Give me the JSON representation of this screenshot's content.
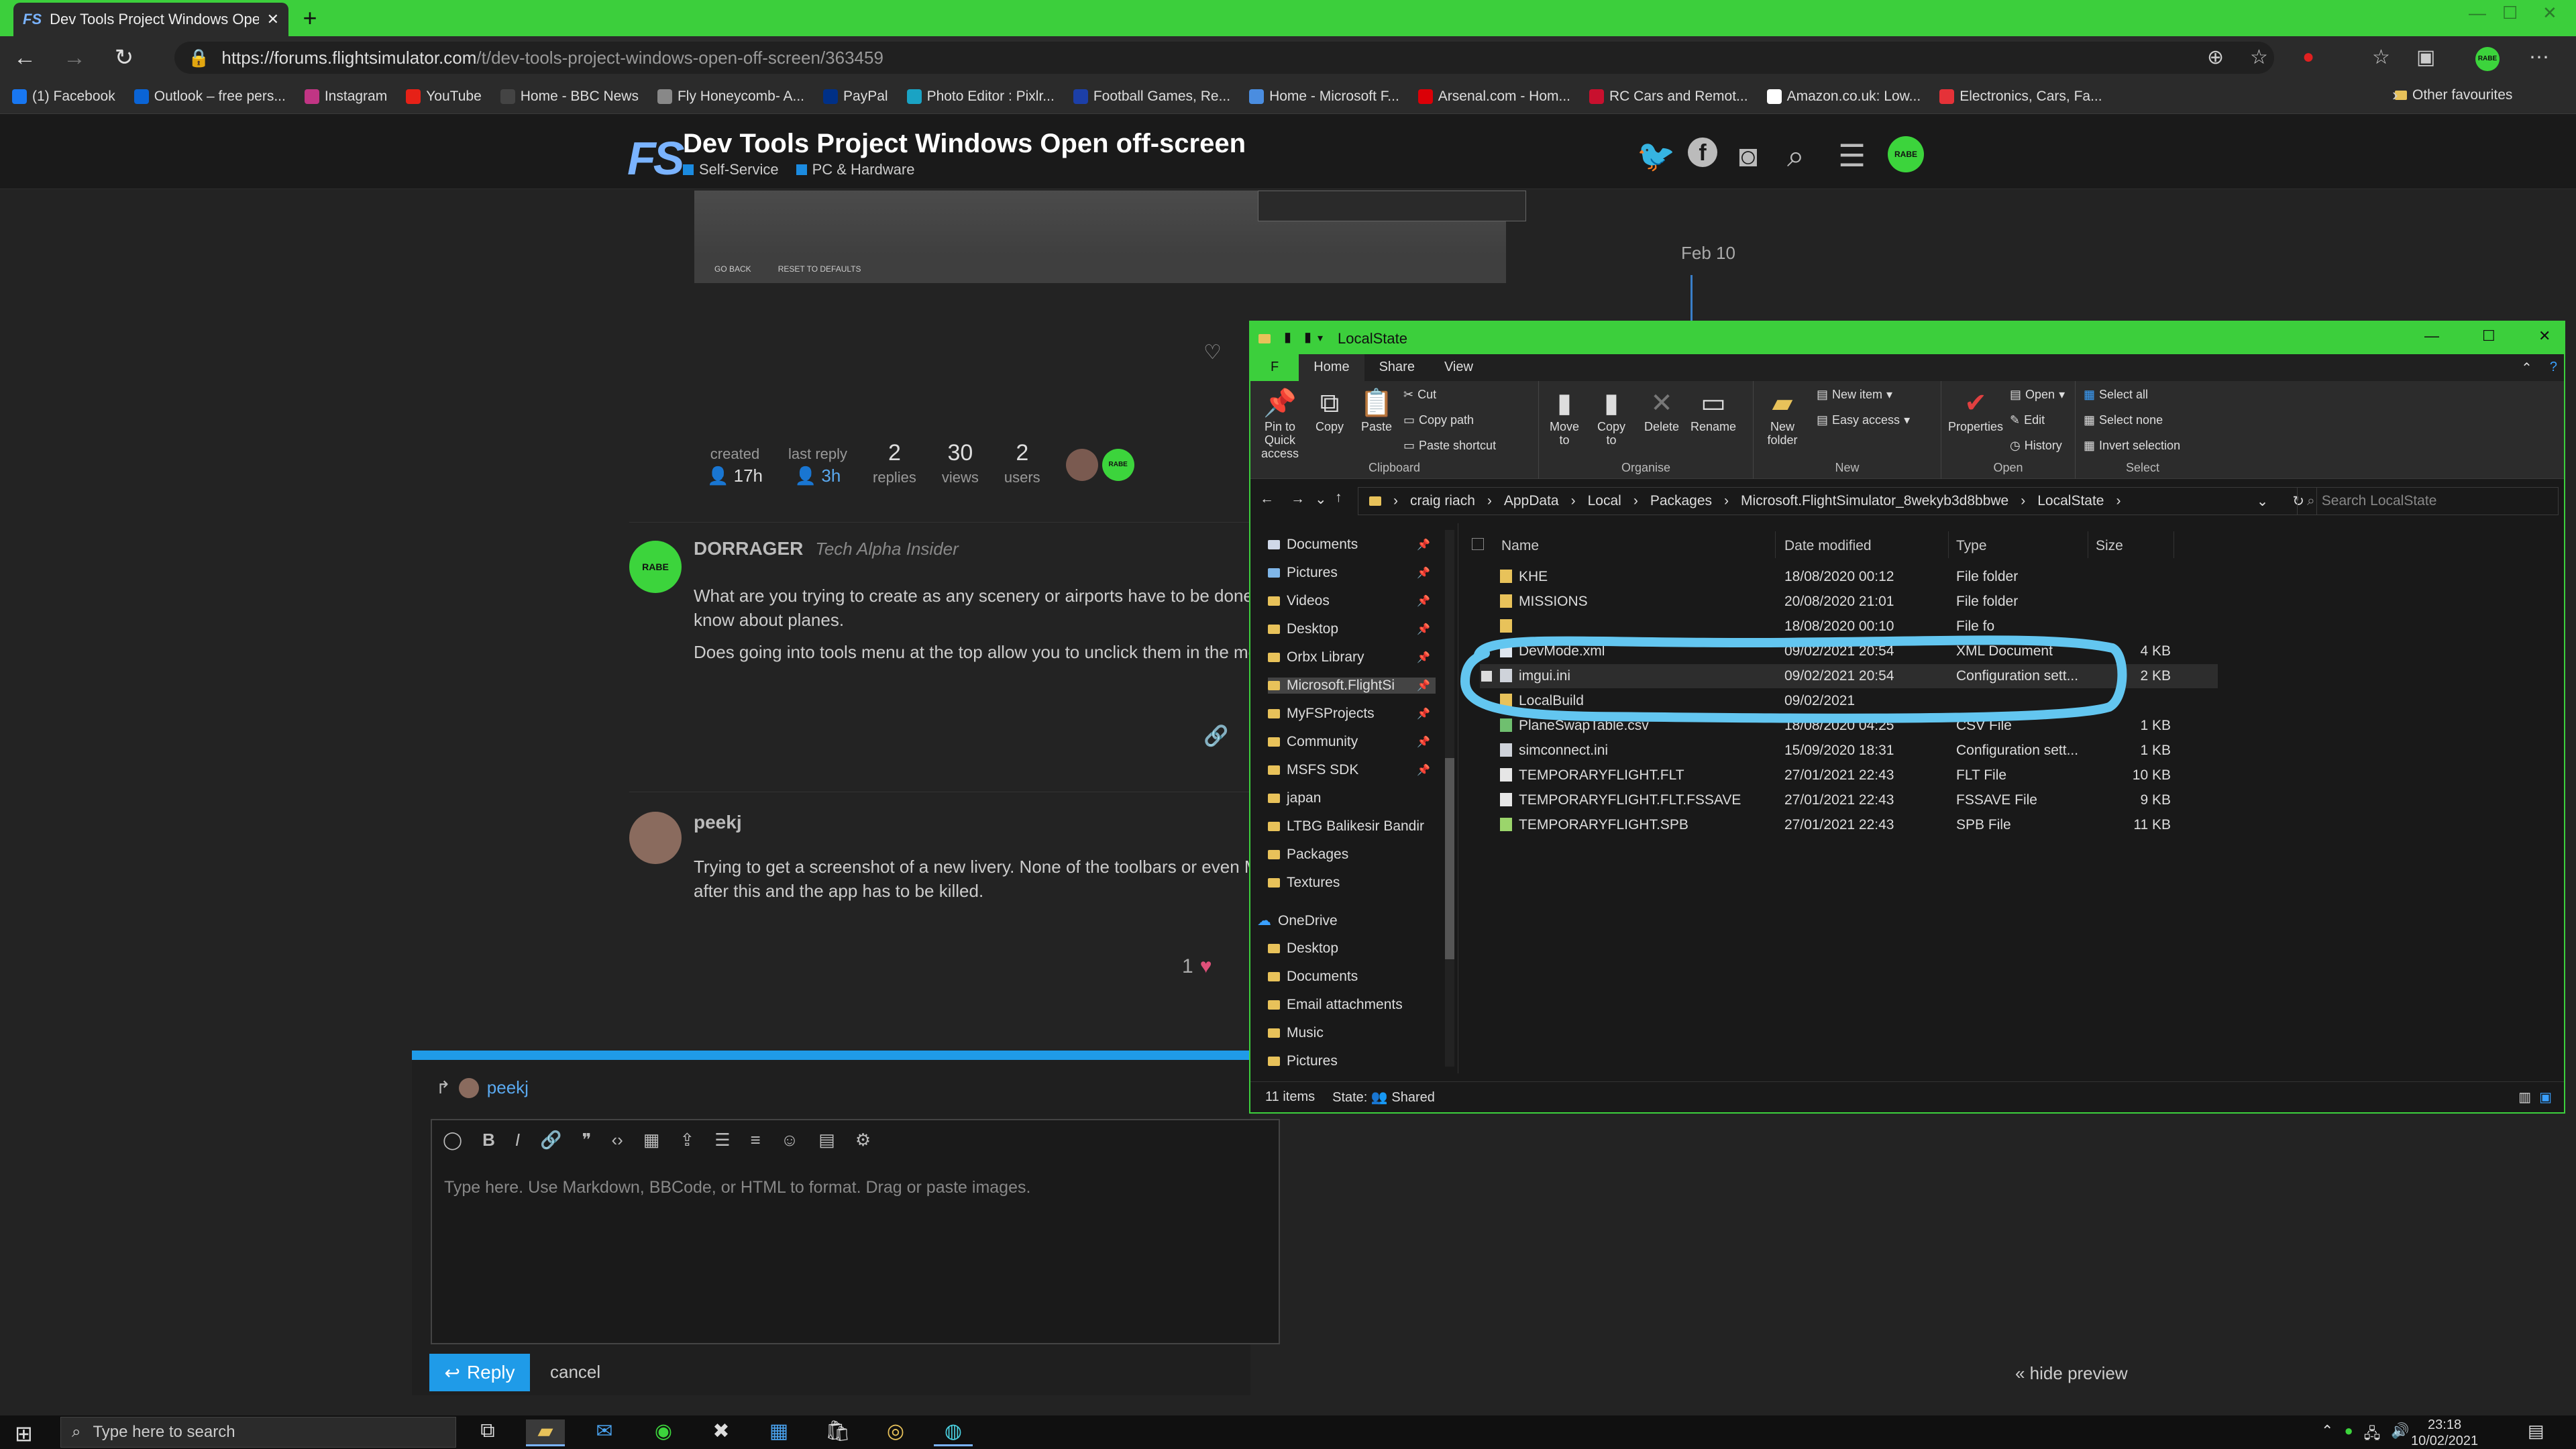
{
  "browser": {
    "tab_title": "Dev Tools Project Windows Open",
    "url_host": "https://forums.flightsimulator.com",
    "url_path": "/t/dev-tools-project-windows-open-off-screen/363459",
    "bookmarks": [
      {
        "label": "(1) Facebook",
        "color": "#1877f2"
      },
      {
        "label": "Outlook – free pers...",
        "color": "#0a64d6"
      },
      {
        "label": "Instagram",
        "color": "#c13584"
      },
      {
        "label": "YouTube",
        "color": "#e62117"
      },
      {
        "label": "Home - BBC News",
        "color": "#444444"
      },
      {
        "label": "Fly Honeycomb- A...",
        "color": "#888888"
      },
      {
        "label": "PayPal",
        "color": "#003087"
      },
      {
        "label": "Photo Editor : Pixlr...",
        "color": "#1aa3c4"
      },
      {
        "label": "Football Games, Re...",
        "color": "#1c3fa8"
      },
      {
        "label": "Home - Microsoft F...",
        "color": "#4a8de0"
      },
      {
        "label": "Arsenal.com - Hom...",
        "color": "#db0007"
      },
      {
        "label": "RC Cars and Remot...",
        "color": "#c8102e"
      },
      {
        "label": "Amazon.co.uk: Low...",
        "color": "#ffffff"
      },
      {
        "label": "Electronics, Cars, Fa...",
        "color": "#e53238"
      }
    ],
    "other_favourites": "Other favourites"
  },
  "site": {
    "logo": "FS",
    "title": "Dev Tools Project Windows Open off-screen",
    "categories": [
      "Self-Service",
      "PC & Hardware"
    ],
    "avatar_text": "RABE",
    "image_buttons": [
      "GO BACK",
      "RESET TO DEFAULTS"
    ],
    "date_marker": "Feb 10",
    "stats": {
      "created_label": "created",
      "created_value": "17h",
      "last_reply_label": "last reply",
      "last_reply_value": "3h",
      "replies_num": "2",
      "replies_label": "replies",
      "views_num": "30",
      "views_label": "views",
      "users_num": "2",
      "users_label": "users"
    },
    "posts": [
      {
        "author": "DORRAGER",
        "flair": "Tech Alpha Insider",
        "line1": "What are you trying to create as any scenery or airports have to be done c",
        "line2": "know about planes.",
        "line3": "Does going into tools menu at the top allow you to unclick them in the me"
      },
      {
        "author": "peekj",
        "flair": "",
        "line1": "Trying to get a screenshot of a new livery. None of the toolbars or even M",
        "line2": "after this and the app has to be killed.",
        "likes": "1"
      }
    ],
    "composer": {
      "reply_to": "peekj",
      "placeholder": "Type here. Use Markdown, BBCode, or HTML to format. Drag or paste images.",
      "reply_label": "Reply",
      "cancel_label": "cancel",
      "hide_preview": "« hide preview"
    }
  },
  "explorer": {
    "title": "LocalState",
    "tabs": [
      "Home",
      "Share",
      "View"
    ],
    "file_tab": "F",
    "ribbon": {
      "pin_label": "Pin to Quick access",
      "copy": "Copy",
      "paste": "Paste",
      "cut": "Cut",
      "copy_path": "Copy path",
      "paste_shortcut": "Paste shortcut",
      "clipboard": "Clipboard",
      "move_to": "Move to",
      "copy_to": "Copy to",
      "delete": "Delete",
      "rename": "Rename",
      "organise": "Organise",
      "new_folder": "New folder",
      "new_item": "New item",
      "easy_access": "Easy access",
      "new": "New",
      "properties": "Properties",
      "open": "Open",
      "edit": "Edit",
      "history": "History",
      "open_group": "Open",
      "select_all": "Select all",
      "select_none": "Select none",
      "invert_selection": "Invert selection",
      "select": "Select"
    },
    "path": [
      "craig riach",
      "AppData",
      "Local",
      "Packages",
      "Microsoft.FlightSimulator_8wekyb3d8bbwe",
      "LocalState"
    ],
    "search_placeholder": "Search LocalState",
    "nav": [
      "Documents",
      "Pictures",
      "Videos",
      "Desktop",
      "Orbx Library",
      "Microsoft.FlightSi",
      "MyFSProjects",
      "Community",
      "MSFS SDK",
      "japan",
      "LTBG Balikesir Bandir",
      "Packages",
      "Textures"
    ],
    "onedrive": "OneDrive",
    "onedrive_items": [
      "Desktop",
      "Documents",
      "Email attachments",
      "Music",
      "Pictures"
    ],
    "columns": {
      "name": "Name",
      "date": "Date modified",
      "type": "Type",
      "size": "Size"
    },
    "files": [
      {
        "name": "KHE",
        "date": "18/08/2020 00:12",
        "type": "File folder",
        "size": "",
        "icon": "folder"
      },
      {
        "name": "MISSIONS",
        "date": "20/08/2020 21:01",
        "type": "File folder",
        "size": "",
        "icon": "folder"
      },
      {
        "name": "",
        "date": "18/08/2020 00:10",
        "type": "File fo",
        "size": "",
        "icon": "folder"
      },
      {
        "name": "DevMode.xml",
        "date": "09/02/2021 20:54",
        "type": "XML Document",
        "size": "4 KB",
        "icon": "xml"
      },
      {
        "name": "imgui.ini",
        "date": "09/02/2021 20:54",
        "type": "Configuration sett...",
        "size": "2 KB",
        "icon": "ini"
      },
      {
        "name": "LocalBuild",
        "date": "09/02/2021",
        "type": "",
        "size": "",
        "icon": "folder"
      },
      {
        "name": "PlaneSwapTable.csv",
        "date": "18/08/2020 04:25",
        "type": "CSV File",
        "size": "1 KB",
        "icon": "csv"
      },
      {
        "name": "simconnect.ini",
        "date": "15/09/2020 18:31",
        "type": "Configuration sett...",
        "size": "1 KB",
        "icon": "ini"
      },
      {
        "name": "TEMPORARYFLIGHT.FLT",
        "date": "27/01/2021 22:43",
        "type": "FLT File",
        "size": "10 KB",
        "icon": "file"
      },
      {
        "name": "TEMPORARYFLIGHT.FLT.FSSAVE",
        "date": "27/01/2021 22:43",
        "type": "FSSAVE File",
        "size": "9 KB",
        "icon": "file"
      },
      {
        "name": "TEMPORARYFLIGHT.SPB",
        "date": "27/01/2021 22:43",
        "type": "SPB File",
        "size": "11 KB",
        "icon": "spb"
      }
    ],
    "status_items": "11 items",
    "status_state": "State:",
    "status_shared": "Shared"
  },
  "taskbar": {
    "search_placeholder": "Type here to search",
    "time": "23:18",
    "date": "10/02/2021"
  },
  "colors": {
    "accent_green": "#3ccf3c",
    "highlight_circle": "#63c6f0",
    "link_blue": "#1f9be8"
  }
}
